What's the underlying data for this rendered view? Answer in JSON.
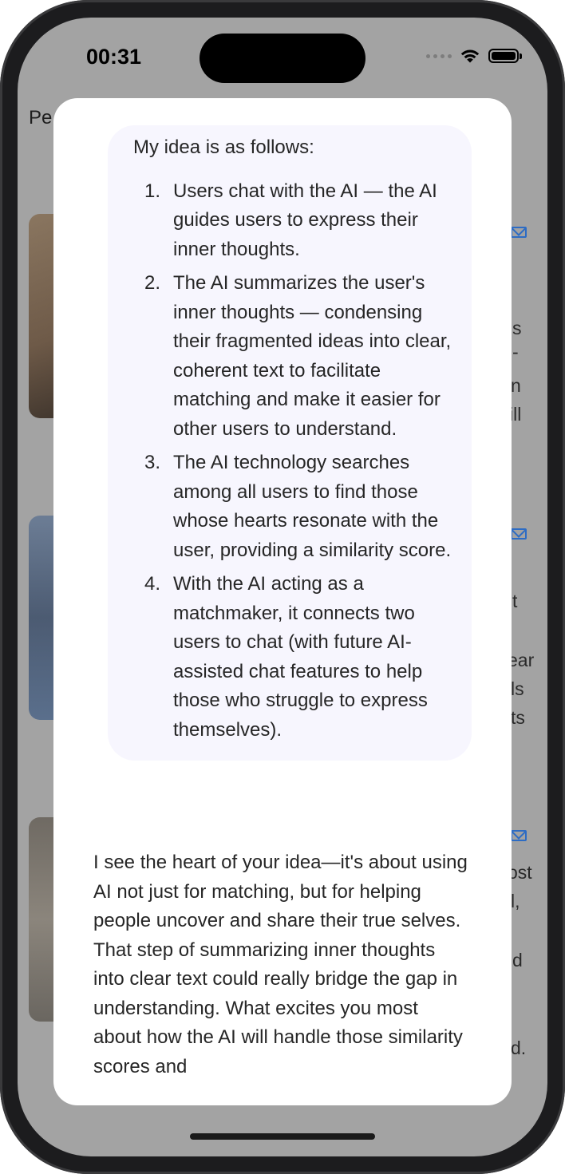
{
  "status_bar": {
    "time": "00:31"
  },
  "background": {
    "title_fragment": "Pe",
    "card_fragments": [
      [
        "s",
        "-",
        "n",
        "ill"
      ],
      [
        "t",
        "ear",
        "ls",
        "ts"
      ],
      [
        "ost",
        "l,",
        "d",
        "d."
      ]
    ]
  },
  "chat": {
    "user_message": {
      "intro": "My idea is as follows:",
      "items": [
        {
          "num": "1.",
          "text": "Users chat with the AI — the AI guides users to express their inner thoughts."
        },
        {
          "num": "2.",
          "text": "The AI summarizes the user's inner thoughts — condensing their fragmented ideas into clear, coherent text to facilitate matching and make it easier for other users to understand."
        },
        {
          "num": "3.",
          "text": "The AI technology searches among all users to find those whose hearts resonate with the user, providing a similarity score."
        },
        {
          "num": "4.",
          "text": "With the AI acting as a matchmaker, it connects two users to chat (with future AI-assisted chat features to help those who struggle to express themselves)."
        }
      ]
    },
    "assistant_message": "I see the heart of your idea—it's about using AI not just for matching, but for helping people uncover and share their true selves. That step of summarizing inner thoughts into clear text could really bridge the gap in understanding. What excites you most about how the AI will handle those similarity scores and"
  },
  "icons": {
    "wifi": "wifi-icon",
    "battery": "battery-icon",
    "mail": "mail-icon"
  },
  "colors": {
    "overlay": "#a3a3a3",
    "bubble": "#f7f6fe",
    "accent": "#2d6cc4"
  }
}
